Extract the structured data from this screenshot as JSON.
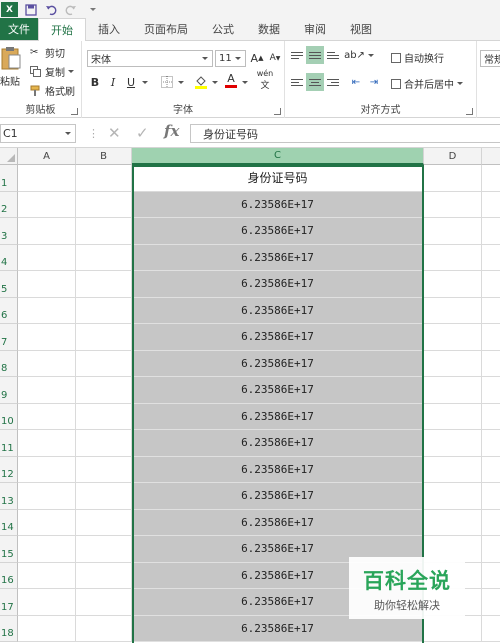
{
  "qat": {
    "app_badge": "X",
    "save_icon": "save-icon",
    "undo_icon": "undo-icon",
    "redo_icon": "redo-icon"
  },
  "tabs": [
    {
      "label": "文件"
    },
    {
      "label": "开始"
    },
    {
      "label": "插入"
    },
    {
      "label": "页面布局"
    },
    {
      "label": "公式"
    },
    {
      "label": "数据"
    },
    {
      "label": "审阅"
    },
    {
      "label": "视图"
    }
  ],
  "clipboard": {
    "paste": "粘贴",
    "cut": "剪切",
    "copy": "复制",
    "format_painter": "格式刷",
    "group": "剪贴板"
  },
  "font": {
    "name": "宋体",
    "size": "11",
    "grow": "A",
    "shrink": "A",
    "bold": "B",
    "italic": "I",
    "underline": "U",
    "font_color": "A",
    "phonetic": "wén",
    "group": "字体"
  },
  "alignment": {
    "wrap": "自动换行",
    "merge": "合并后居中",
    "group": "对齐方式"
  },
  "number": {
    "format": "常规"
  },
  "formula_bar": {
    "name_box": "C1",
    "fx": "fx",
    "content": "身份证号码"
  },
  "columns": [
    "A",
    "B",
    "C",
    "D"
  ],
  "rows": [
    {
      "n": "1",
      "c": "身份证号码"
    },
    {
      "n": "2",
      "c": "6.23586E+17"
    },
    {
      "n": "3",
      "c": "6.23586E+17"
    },
    {
      "n": "4",
      "c": "6.23586E+17"
    },
    {
      "n": "5",
      "c": "6.23586E+17"
    },
    {
      "n": "6",
      "c": "6.23586E+17"
    },
    {
      "n": "7",
      "c": "6.23586E+17"
    },
    {
      "n": "8",
      "c": "6.23586E+17"
    },
    {
      "n": "9",
      "c": "6.23586E+17"
    },
    {
      "n": "10",
      "c": "6.23586E+17"
    },
    {
      "n": "11",
      "c": "6.23586E+17"
    },
    {
      "n": "12",
      "c": "6.23586E+17"
    },
    {
      "n": "13",
      "c": "6.23586E+17"
    },
    {
      "n": "14",
      "c": "6.23586E+17"
    },
    {
      "n": "15",
      "c": "6.23586E+17"
    },
    {
      "n": "16",
      "c": "6.23586E+17"
    },
    {
      "n": "17",
      "c": "6.23586E+17"
    },
    {
      "n": "18",
      "c": "6.23586E+17"
    }
  ],
  "watermark": {
    "title": "百科全说",
    "subtitle": "助你轻松解决"
  },
  "colors": {
    "accent": "#217346",
    "selection": "#c6c6c6",
    "header_active": "#9fd2b0"
  }
}
